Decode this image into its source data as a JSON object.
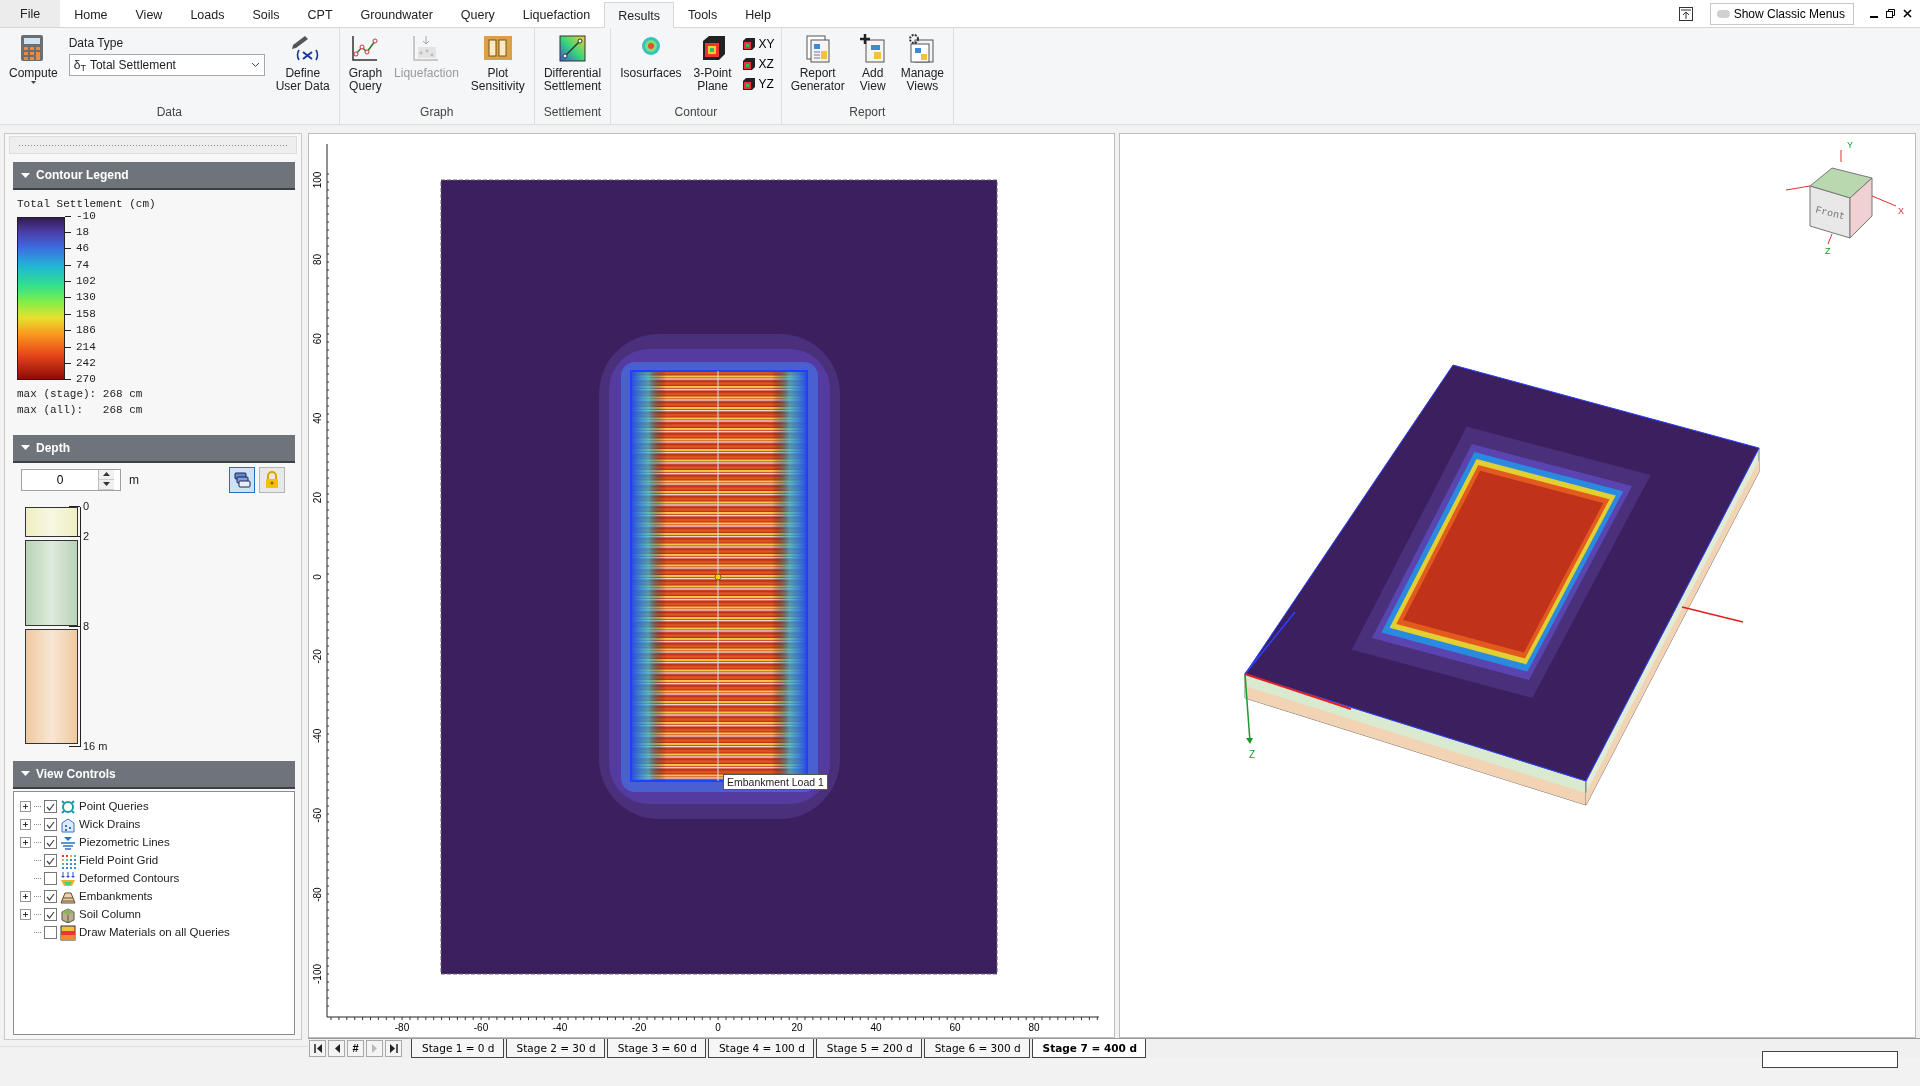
{
  "menu_tabs": [
    {
      "label": "File",
      "kind": "file",
      "selected": false
    },
    {
      "label": "Home",
      "kind": "tab",
      "selected": false
    },
    {
      "label": "View",
      "kind": "tab",
      "selected": false
    },
    {
      "label": "Loads",
      "kind": "tab",
      "selected": false
    },
    {
      "label": "Soils",
      "kind": "tab",
      "selected": false
    },
    {
      "label": "CPT",
      "kind": "tab",
      "selected": false
    },
    {
      "label": "Groundwater",
      "kind": "tab",
      "selected": false
    },
    {
      "label": "Query",
      "kind": "tab",
      "selected": false
    },
    {
      "label": "Liquefaction",
      "kind": "tab",
      "selected": false
    },
    {
      "label": "Results",
      "kind": "tab",
      "selected": true
    },
    {
      "label": "Tools",
      "kind": "tab",
      "selected": false
    },
    {
      "label": "Help",
      "kind": "tab",
      "selected": false
    }
  ],
  "classic_menus": {
    "label": "Show Classic Menus",
    "on": false
  },
  "ribbon_groups": [
    {
      "label": "Data",
      "items": [
        {
          "kind": "large",
          "lines": [
            "Compute"
          ],
          "dropdown": true,
          "disabled": false
        },
        {
          "kind": "select",
          "label": "Data Type",
          "symbol": "δ$_{T}$",
          "value": "Total Settlement"
        },
        {
          "kind": "large",
          "lines": [
            "Define",
            "User Data"
          ],
          "dropdown": false,
          "disabled": false
        }
      ]
    },
    {
      "label": "Graph",
      "items": [
        {
          "kind": "large",
          "lines": [
            "Graph",
            "Query"
          ],
          "dropdown": false,
          "disabled": false
        },
        {
          "kind": "large",
          "lines": [
            "Liquefaction"
          ],
          "dropdown": false,
          "disabled": true
        },
        {
          "kind": "large",
          "lines": [
            "Plot",
            "Sensitivity"
          ],
          "dropdown": false,
          "disabled": false
        }
      ]
    },
    {
      "label": "Settlement",
      "items": [
        {
          "kind": "large",
          "lines": [
            "Differential",
            "Settlement"
          ],
          "dropdown": false,
          "disabled": false
        }
      ]
    },
    {
      "label": "Contour",
      "items": [
        {
          "kind": "large",
          "lines": [
            "Isosurfaces"
          ],
          "dropdown": false,
          "disabled": false
        },
        {
          "kind": "large",
          "lines": [
            "3-Point",
            "Plane"
          ],
          "dropdown": false,
          "disabled": false
        },
        {
          "kind": "stack",
          "buttons": [
            "XY",
            "XZ",
            "YZ"
          ]
        }
      ]
    },
    {
      "label": "Report",
      "items": [
        {
          "kind": "large",
          "lines": [
            "Report",
            "Generator"
          ],
          "dropdown": false,
          "disabled": false
        },
        {
          "kind": "large",
          "lines": [
            "Add",
            "View"
          ],
          "dropdown": false,
          "disabled": false
        },
        {
          "kind": "large",
          "lines": [
            "Manage",
            "Views"
          ],
          "dropdown": false,
          "disabled": false
        }
      ]
    }
  ],
  "contour_legend": {
    "title": "Contour Legend",
    "expanded": true,
    "quantity": "Total Settlement (cm)",
    "ticks": [
      "-10",
      "18",
      "46",
      "74",
      "102",
      "130",
      "158",
      "186",
      "214",
      "242",
      "270"
    ],
    "stats": [
      "max (stage): 268 cm",
      "max (all):   268 cm"
    ]
  },
  "depth": {
    "title": "Depth",
    "expanded": true,
    "value": "0",
    "unit": "m",
    "layers": [
      {
        "color": "#efeec2"
      },
      {
        "color": "#b9d3b6"
      },
      {
        "color": "#efc9a1"
      }
    ],
    "marks": [
      "0",
      "2",
      "8",
      "16 m"
    ]
  },
  "view_controls": {
    "title": "View Controls",
    "expanded": true,
    "items": [
      {
        "label": "Point Queries",
        "checked": true,
        "expandable": true
      },
      {
        "label": "Wick Drains",
        "checked": true,
        "expandable": true
      },
      {
        "label": "Piezometric Lines",
        "checked": true,
        "expandable": true
      },
      {
        "label": "Field Point Grid",
        "checked": true,
        "expandable": false
      },
      {
        "label": "Deformed Contours",
        "checked": false,
        "expandable": false
      },
      {
        "label": "Embankments",
        "checked": true,
        "expandable": true
      },
      {
        "label": "Soil Column",
        "checked": true,
        "expandable": true
      },
      {
        "label": "Draw Materials on all Queries",
        "checked": false,
        "expandable": false
      }
    ]
  },
  "view_2d": {
    "x_ruler": [
      "-80",
      "-60",
      "-40",
      "-20",
      "0",
      "20",
      "40",
      "60",
      "80"
    ],
    "y_ruler": [
      "100",
      "80",
      "60",
      "40",
      "20",
      "0",
      "-20",
      "-40",
      "-60",
      "-80",
      "-100"
    ],
    "tooltip": "Embankment Load 1"
  },
  "view_3d": {
    "cube_front": "Front",
    "cube_axes": [
      "X",
      "Y",
      "Z"
    ],
    "axis_label": "Z"
  },
  "stage_nav_label": "#",
  "stage_tabs": [
    {
      "label": "Stage 1 = 0 d",
      "selected": false
    },
    {
      "label": "Stage 2 = 30 d",
      "selected": false
    },
    {
      "label": "Stage 3 = 60 d",
      "selected": false
    },
    {
      "label": "Stage 4 = 100 d",
      "selected": false
    },
    {
      "label": "Stage 5 = 200 d",
      "selected": false
    },
    {
      "label": "Stage 6 = 300 d",
      "selected": false
    },
    {
      "label": "Stage 7 = 400 d",
      "selected": true
    }
  ]
}
